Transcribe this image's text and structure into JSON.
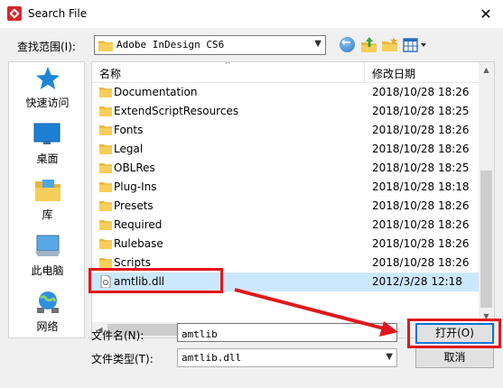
{
  "window": {
    "title": "Search File",
    "close_symbol": "✕"
  },
  "lookin": {
    "label": "查找范围(I):",
    "value": "Adobe InDesign CS6"
  },
  "places": [
    {
      "label": "快速访问",
      "icon": "star-icon"
    },
    {
      "label": "桌面",
      "icon": "desktop-icon"
    },
    {
      "label": "库",
      "icon": "library-icon"
    },
    {
      "label": "此电脑",
      "icon": "computer-icon"
    },
    {
      "label": "网络",
      "icon": "network-icon"
    }
  ],
  "columns": {
    "name": "名称",
    "date": "修改日期"
  },
  "files": [
    {
      "name": "Documentation",
      "date": "2018/10/28 18:26",
      "type": "folder"
    },
    {
      "name": "ExtendScriptResources",
      "date": "2018/10/28 18:25",
      "type": "folder"
    },
    {
      "name": "Fonts",
      "date": "2018/10/28 18:26",
      "type": "folder"
    },
    {
      "name": "Legal",
      "date": "2018/10/28 18:26",
      "type": "folder"
    },
    {
      "name": "OBLRes",
      "date": "2018/10/28 18:25",
      "type": "folder"
    },
    {
      "name": "Plug-Ins",
      "date": "2018/10/28 18:18",
      "type": "folder"
    },
    {
      "name": "Presets",
      "date": "2018/10/28 18:26",
      "type": "folder"
    },
    {
      "name": "Required",
      "date": "2018/10/28 18:26",
      "type": "folder"
    },
    {
      "name": "Rulebase",
      "date": "2018/10/28 18:26",
      "type": "folder"
    },
    {
      "name": "Scripts",
      "date": "2018/10/28 18:26",
      "type": "folder"
    },
    {
      "name": "amtlib.dll",
      "date": "2012/3/28 12:18",
      "type": "file"
    }
  ],
  "filename": {
    "label": "文件名(N):",
    "value": "amtlib"
  },
  "filetype": {
    "label": "文件类型(T):",
    "value": "amtlib.dll"
  },
  "buttons": {
    "open": "打开(O)",
    "cancel": "取消"
  },
  "colors": {
    "highlight": "#e0181b",
    "selection": "#cce8ff",
    "folder": "#f2c440"
  }
}
